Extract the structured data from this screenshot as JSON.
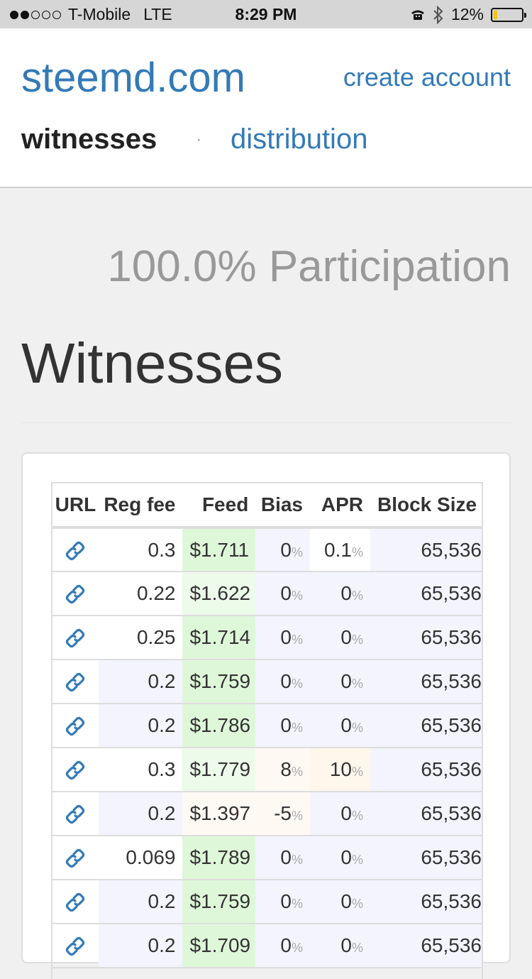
{
  "status_bar": {
    "carrier": "T-Mobile",
    "network": "LTE",
    "time": "8:29 PM",
    "battery": "12%",
    "battery_level": 0.12
  },
  "header": {
    "brand": "steemd.com",
    "create_account": "create account",
    "nav": {
      "witnesses": "witnesses",
      "separator": "·",
      "distribution": "distribution"
    }
  },
  "participation": "100.0% Participation",
  "page_title": "Witnesses",
  "table": {
    "columns": [
      "URL",
      "Reg fee",
      "Feed",
      "Bias",
      "APR",
      "Block Size"
    ],
    "pct_symbol": "%",
    "rows": [
      {
        "reg_fee": "0.3",
        "feed": "$1.711",
        "bias": "0",
        "apr": "0.1",
        "block_size": "65,536",
        "reg_bg": "none",
        "feed_bg": "green",
        "bias_bg": "blue",
        "apr_bg": "none"
      },
      {
        "reg_fee": "0.22",
        "feed": "$1.622",
        "bias": "0",
        "apr": "0",
        "block_size": "65,536",
        "reg_bg": "none",
        "feed_bg": "green-lt",
        "bias_bg": "blue",
        "apr_bg": "blue"
      },
      {
        "reg_fee": "0.25",
        "feed": "$1.714",
        "bias": "0",
        "apr": "0",
        "block_size": "65,536",
        "reg_bg": "none",
        "feed_bg": "green",
        "bias_bg": "blue",
        "apr_bg": "blue"
      },
      {
        "reg_fee": "0.2",
        "feed": "$1.759",
        "bias": "0",
        "apr": "0",
        "block_size": "65,536",
        "reg_bg": "blue",
        "feed_bg": "green",
        "bias_bg": "blue",
        "apr_bg": "blue"
      },
      {
        "reg_fee": "0.2",
        "feed": "$1.786",
        "bias": "0",
        "apr": "0",
        "block_size": "65,536",
        "reg_bg": "blue",
        "feed_bg": "green",
        "bias_bg": "blue",
        "apr_bg": "blue"
      },
      {
        "reg_fee": "0.3",
        "feed": "$1.779",
        "bias": "8",
        "apr": "10",
        "block_size": "65,536",
        "reg_bg": "none",
        "feed_bg": "green-lt",
        "bias_bg": "peach-lt",
        "apr_bg": "peach"
      },
      {
        "reg_fee": "0.2",
        "feed": "$1.397",
        "bias": "-5",
        "apr": "0",
        "block_size": "65,536",
        "reg_bg": "blue",
        "feed_bg": "peach-lt",
        "bias_bg": "peach-lt",
        "apr_bg": "blue"
      },
      {
        "reg_fee": "0.069",
        "feed": "$1.789",
        "bias": "0",
        "apr": "0",
        "block_size": "65,536",
        "reg_bg": "none",
        "feed_bg": "green",
        "bias_bg": "blue",
        "apr_bg": "blue"
      },
      {
        "reg_fee": "0.2",
        "feed": "$1.759",
        "bias": "0",
        "apr": "0",
        "block_size": "65,536",
        "reg_bg": "blue",
        "feed_bg": "green",
        "bias_bg": "blue",
        "apr_bg": "blue"
      },
      {
        "reg_fee": "0.2",
        "feed": "$1.709",
        "bias": "0",
        "apr": "0",
        "block_size": "65,536",
        "reg_bg": "blue",
        "feed_bg": "green",
        "bias_bg": "blue",
        "apr_bg": "blue"
      }
    ]
  },
  "colors": {
    "link": "#337ab7",
    "cell_blue": "#f3f4fd",
    "cell_green": "#dff7d9",
    "cell_peach": "#fff6ec"
  },
  "icons": {
    "row_link": "link-icon",
    "bluetooth": "bluetooth-icon",
    "alarm": "alarm-icon"
  }
}
